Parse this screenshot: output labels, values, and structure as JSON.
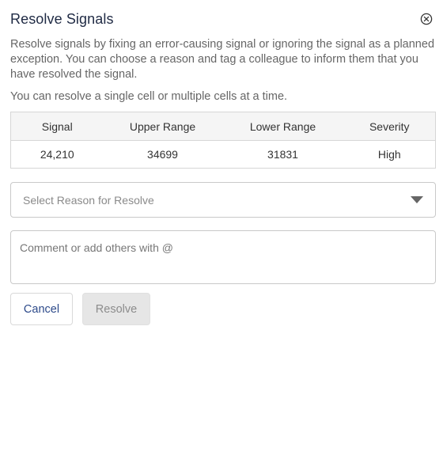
{
  "dialog": {
    "title": "Resolve Signals",
    "close_icon": "close-circle-icon",
    "description": "Resolve signals by fixing an error-causing signal or ignoring the signal as a planned exception. You can choose a reason and tag a colleague to inform them that you have resolved the signal.",
    "note": "You can resolve a single cell or multiple cells at a time."
  },
  "table": {
    "headers": [
      "Signal",
      "Upper Range",
      "Lower Range",
      "Severity"
    ],
    "rows": [
      {
        "signal": "24,210",
        "upper": "34699",
        "lower": "31831",
        "severity": "High"
      }
    ],
    "severity_color": "#d0312d"
  },
  "reason_select": {
    "placeholder": "Select Reason for Resolve",
    "caret_icon": "caret-down-icon"
  },
  "comment": {
    "placeholder": "Comment or add others with @",
    "value": ""
  },
  "actions": {
    "cancel_label": "Cancel",
    "resolve_label": "Resolve",
    "resolve_disabled": true
  },
  "colors": {
    "title": "#1f2a44",
    "cancel_text": "#2d4a8a",
    "disabled_bg": "#e6e6e6"
  }
}
